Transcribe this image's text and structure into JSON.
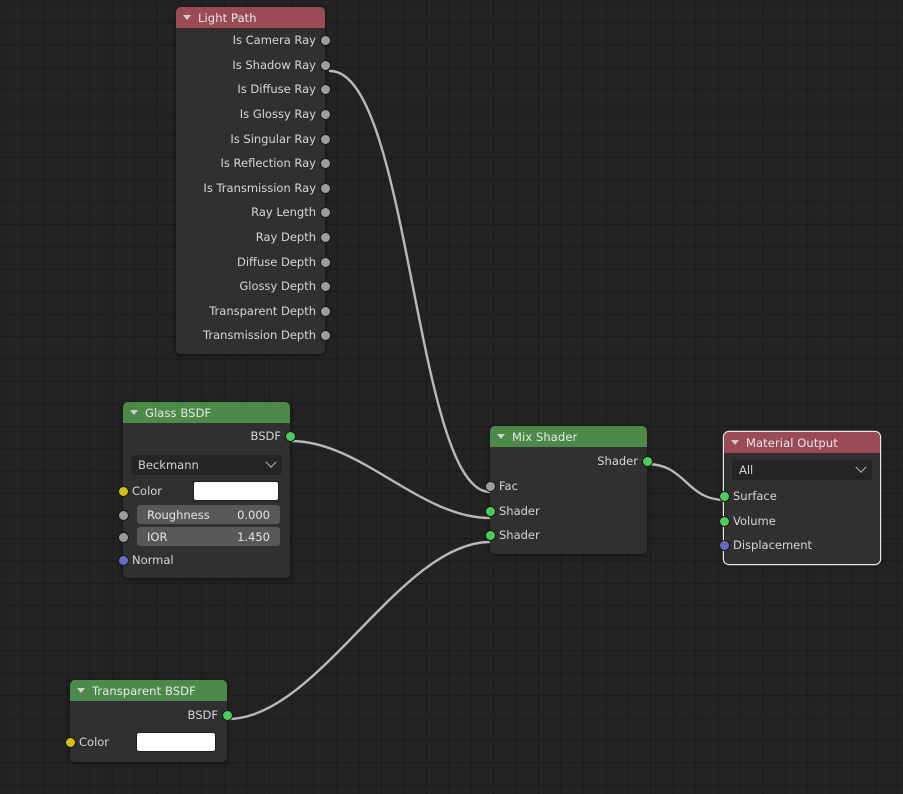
{
  "editor": {
    "name": "Blender Shader Node Editor",
    "background_color": "#232323",
    "grid_color": "#1b1b1b",
    "noodle_color": "#b9b9b9"
  },
  "socket_colors": {
    "shader": "#4ccc5a",
    "value": "#9d9d9d",
    "color": "#d2c209",
    "vector": "#6a6ac4"
  },
  "header_colors": {
    "input": "#9a4b55",
    "output": "#9a4b55",
    "shader": "#4d8a49"
  },
  "nodes": {
    "light_path": {
      "title": "Light Path",
      "header_color": "#9a4b55",
      "outputs": [
        {
          "label": "Is Camera Ray",
          "socket": "value"
        },
        {
          "label": "Is Shadow Ray",
          "socket": "value"
        },
        {
          "label": "Is Diffuse Ray",
          "socket": "value"
        },
        {
          "label": "Is Glossy Ray",
          "socket": "value"
        },
        {
          "label": "Is Singular Ray",
          "socket": "value"
        },
        {
          "label": "Is Reflection Ray",
          "socket": "value"
        },
        {
          "label": "Is Transmission Ray",
          "socket": "value"
        },
        {
          "label": "Ray Length",
          "socket": "value"
        },
        {
          "label": "Ray Depth",
          "socket": "value"
        },
        {
          "label": "Diffuse Depth",
          "socket": "value"
        },
        {
          "label": "Glossy Depth",
          "socket": "value"
        },
        {
          "label": "Transparent Depth",
          "socket": "value"
        },
        {
          "label": "Transmission Depth",
          "socket": "value"
        }
      ]
    },
    "glass_bsdf": {
      "title": "Glass BSDF",
      "header_color": "#4d8a49",
      "output_label": "BSDF",
      "distribution": "Beckmann",
      "color_label": "Color",
      "color_value": "#ffffff",
      "roughness_label": "Roughness",
      "roughness_value": "0.000",
      "ior_label": "IOR",
      "ior_value": "1.450",
      "normal_label": "Normal"
    },
    "mix_shader": {
      "title": "Mix Shader",
      "header_color": "#4d8a49",
      "output_label": "Shader",
      "inputs": [
        {
          "label": "Fac",
          "socket": "value"
        },
        {
          "label": "Shader",
          "socket": "shader"
        },
        {
          "label": "Shader",
          "socket": "shader"
        }
      ]
    },
    "material_output": {
      "title": "Material Output",
      "header_color": "#9a4b55",
      "selected": true,
      "target": "All",
      "inputs": [
        {
          "label": "Surface",
          "socket": "shader"
        },
        {
          "label": "Volume",
          "socket": "shader"
        },
        {
          "label": "Displacement",
          "socket": "vector"
        }
      ]
    },
    "transparent_bsdf": {
      "title": "Transparent BSDF",
      "header_color": "#4d8a49",
      "output_label": "BSDF",
      "color_label": "Color",
      "color_value": "#ffffff"
    }
  },
  "links": [
    {
      "from": "light_path.Is Shadow Ray",
      "to": "mix_shader.Fac"
    },
    {
      "from": "glass_bsdf.BSDF",
      "to": "mix_shader.Shader1"
    },
    {
      "from": "transparent_bsdf.BSDF",
      "to": "mix_shader.Shader2"
    },
    {
      "from": "mix_shader.Shader",
      "to": "material_output.Surface"
    }
  ]
}
